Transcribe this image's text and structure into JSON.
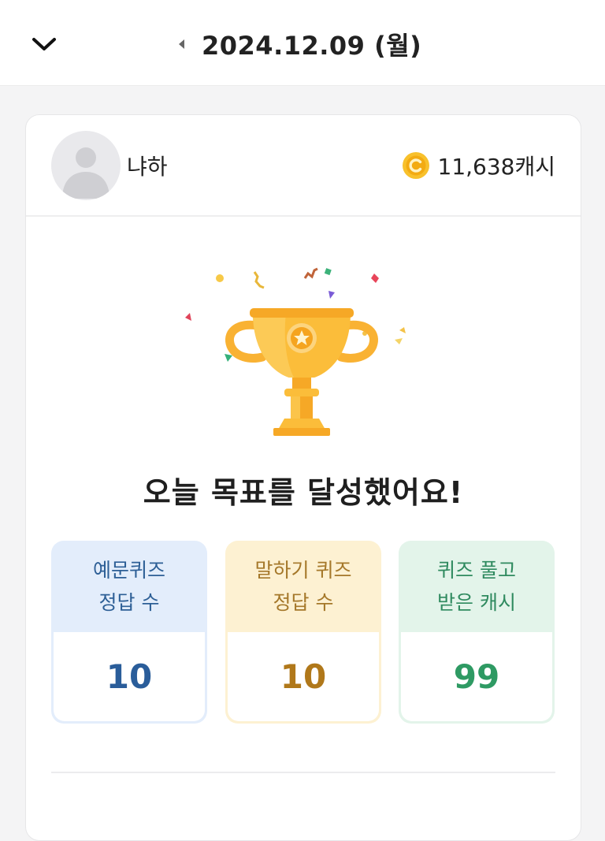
{
  "header": {
    "date_title": "2024.12.09 (월)"
  },
  "profile": {
    "username": "냐하",
    "cash": "11,638캐시"
  },
  "goal": {
    "title": "오늘 목표를 달성했어요!"
  },
  "stats": [
    {
      "label_line1": "예문퀴즈",
      "label_line2": "정답 수",
      "value": "10",
      "color": "#2a5d9a"
    },
    {
      "label_line1": "말하기 퀴즈",
      "label_line2": "정답 수",
      "value": "10",
      "color": "#b0781a"
    },
    {
      "label_line1": "퀴즈 풀고",
      "label_line2": "받은 캐시",
      "value": "99",
      "color": "#2e9a63"
    }
  ],
  "colors": {
    "trophy": "#f9b233",
    "coin": "#f8c12c"
  }
}
